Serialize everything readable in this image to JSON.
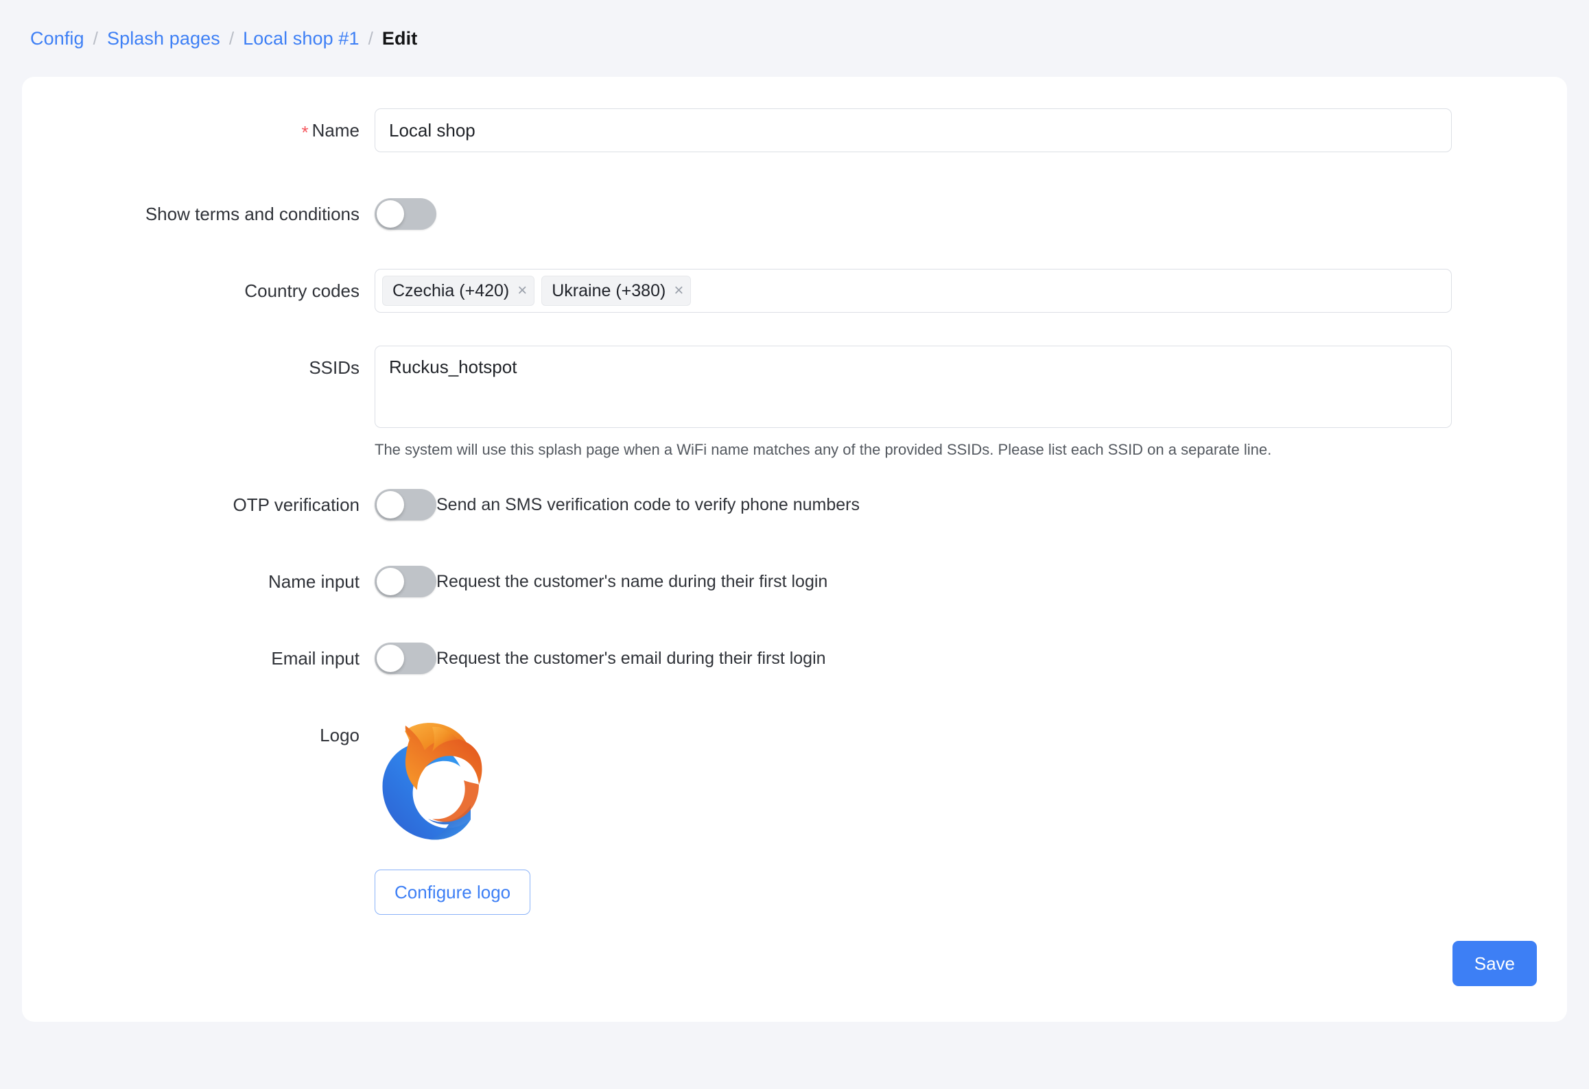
{
  "breadcrumb": {
    "separator": "/",
    "items": [
      {
        "label": "Config",
        "current": false
      },
      {
        "label": "Splash pages",
        "current": false
      },
      {
        "label": "Local shop #1",
        "current": false
      },
      {
        "label": "Edit",
        "current": true
      }
    ]
  },
  "form": {
    "name": {
      "label": "Name",
      "required_marker": "*",
      "value": "Local shop",
      "placeholder": ""
    },
    "show_terms": {
      "label": "Show terms and conditions",
      "enabled": false
    },
    "country_codes": {
      "label": "Country codes",
      "tags": [
        {
          "label": "Czechia (+420)",
          "remove": "×"
        },
        {
          "label": "Ukraine (+380)",
          "remove": "×"
        }
      ]
    },
    "ssids": {
      "label": "SSIDs",
      "value": "Ruckus_hotspot",
      "help": "The system will use this splash page when a WiFi name matches any of the provided SSIDs. Please list each SSID on a separate line."
    },
    "otp_verification": {
      "label": "OTP verification",
      "enabled": false,
      "description": "Send an SMS verification code to verify phone numbers"
    },
    "name_input": {
      "label": "Name input",
      "enabled": false,
      "description": "Request the customer's name during their first login"
    },
    "email_input": {
      "label": "Email input",
      "enabled": false,
      "description": "Request the customer's email during their first login"
    },
    "logo": {
      "label": "Logo",
      "icon_name": "brand-flame-crescent-logo",
      "configure_button": "Configure logo"
    },
    "save_button": "Save"
  },
  "colors": {
    "accent": "#3d7ff5",
    "page_background": "#f4f5f9",
    "card_background": "#ffffff",
    "required": "#f5555c",
    "toggle_off": "#bfc3c8",
    "logo_orange": "#f59a27",
    "logo_orange_dark": "#e0511f",
    "logo_blue": "#2f6fe0",
    "logo_blue_light": "#2f9cf0"
  }
}
